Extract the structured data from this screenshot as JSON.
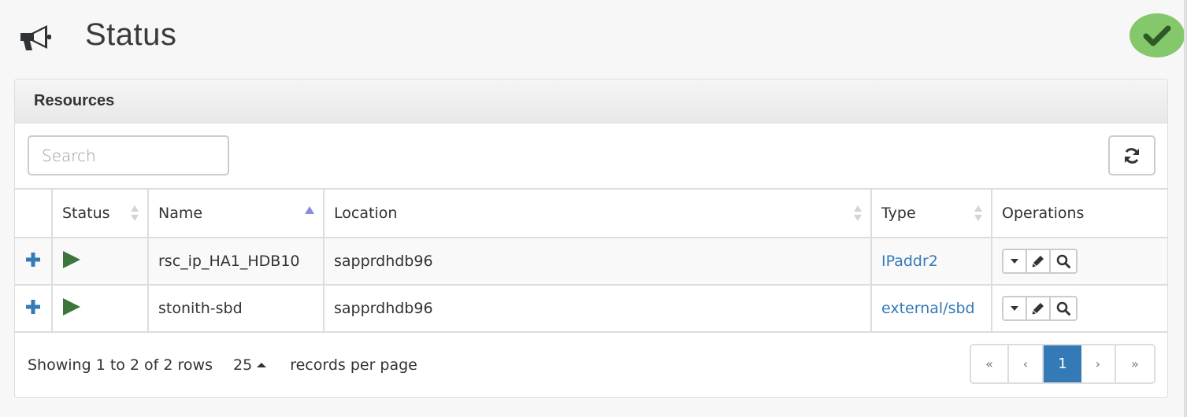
{
  "header": {
    "icon": "megaphone-icon",
    "title": "Status",
    "status_indicator": {
      "icon": "check-icon",
      "color": "#85c76b",
      "state": "ok"
    }
  },
  "panel": {
    "title": "Resources",
    "search": {
      "placeholder": "Search",
      "value": ""
    },
    "refresh_icon": "refresh-icon"
  },
  "table": {
    "columns": [
      {
        "label": "",
        "sort": "none"
      },
      {
        "label": "Status",
        "sort": "both"
      },
      {
        "label": "Name",
        "sort": "asc"
      },
      {
        "label": "Location",
        "sort": "both"
      },
      {
        "label": "Type",
        "sort": "both"
      },
      {
        "label": "Operations",
        "sort": "none"
      }
    ],
    "rows": [
      {
        "expand_icon": "plus-icon",
        "status_icon": "play-icon",
        "name": "rsc_ip_HA1_HDB10",
        "location": "sapprdhdb96",
        "type": "IPaddr2"
      },
      {
        "expand_icon": "plus-icon",
        "status_icon": "play-icon",
        "name": "stonith-sbd",
        "location": "sapprdhdb96",
        "type": "external/sbd"
      }
    ],
    "operations": [
      "caret-down-icon",
      "pencil-icon",
      "search-icon"
    ]
  },
  "footer": {
    "showing_text": "Showing 1 to 2 of 2 rows",
    "page_size": "25",
    "per_page_label": "records per page",
    "pagination": {
      "first": "«",
      "prev": "‹",
      "current": "1",
      "next": "›",
      "last": "»"
    }
  },
  "colors": {
    "accent": "#337ab7",
    "running": "#3c763d",
    "ok_badge": "#85c76b",
    "ok_check": "#2b5a27"
  }
}
